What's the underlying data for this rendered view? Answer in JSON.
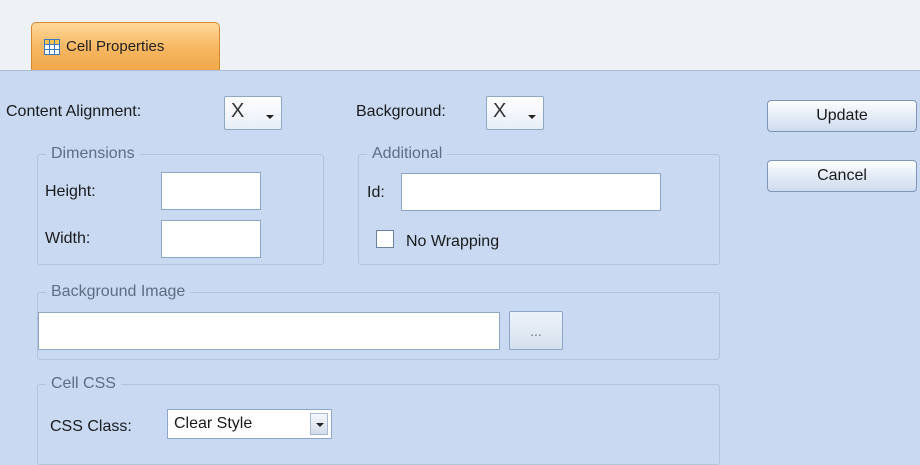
{
  "tab": {
    "icon": "table-icon",
    "label": "Cell Properties"
  },
  "content_alignment": {
    "label": "Content Alignment:",
    "value_icon": "x-icon",
    "value": "X"
  },
  "background": {
    "label": "Background:",
    "value_icon": "x-icon",
    "value": "X"
  },
  "buttons": {
    "update": "Update",
    "cancel": "Cancel"
  },
  "dimensions": {
    "legend": "Dimensions",
    "height_label": "Height:",
    "height_value": "",
    "width_label": "Width:",
    "width_value": ""
  },
  "additional": {
    "legend": "Additional",
    "id_label": "Id:",
    "id_value": "",
    "no_wrapping_label": "No Wrapping",
    "no_wrapping_checked": false
  },
  "background_image": {
    "legend": "Background Image",
    "value": "",
    "browse_label": "..."
  },
  "cell_css": {
    "legend": "Cell CSS",
    "class_label": "CSS Class:",
    "class_value": "Clear Style"
  },
  "colors": {
    "tab_accent": "#f7b660",
    "panel_background": "#c9d9f2"
  }
}
